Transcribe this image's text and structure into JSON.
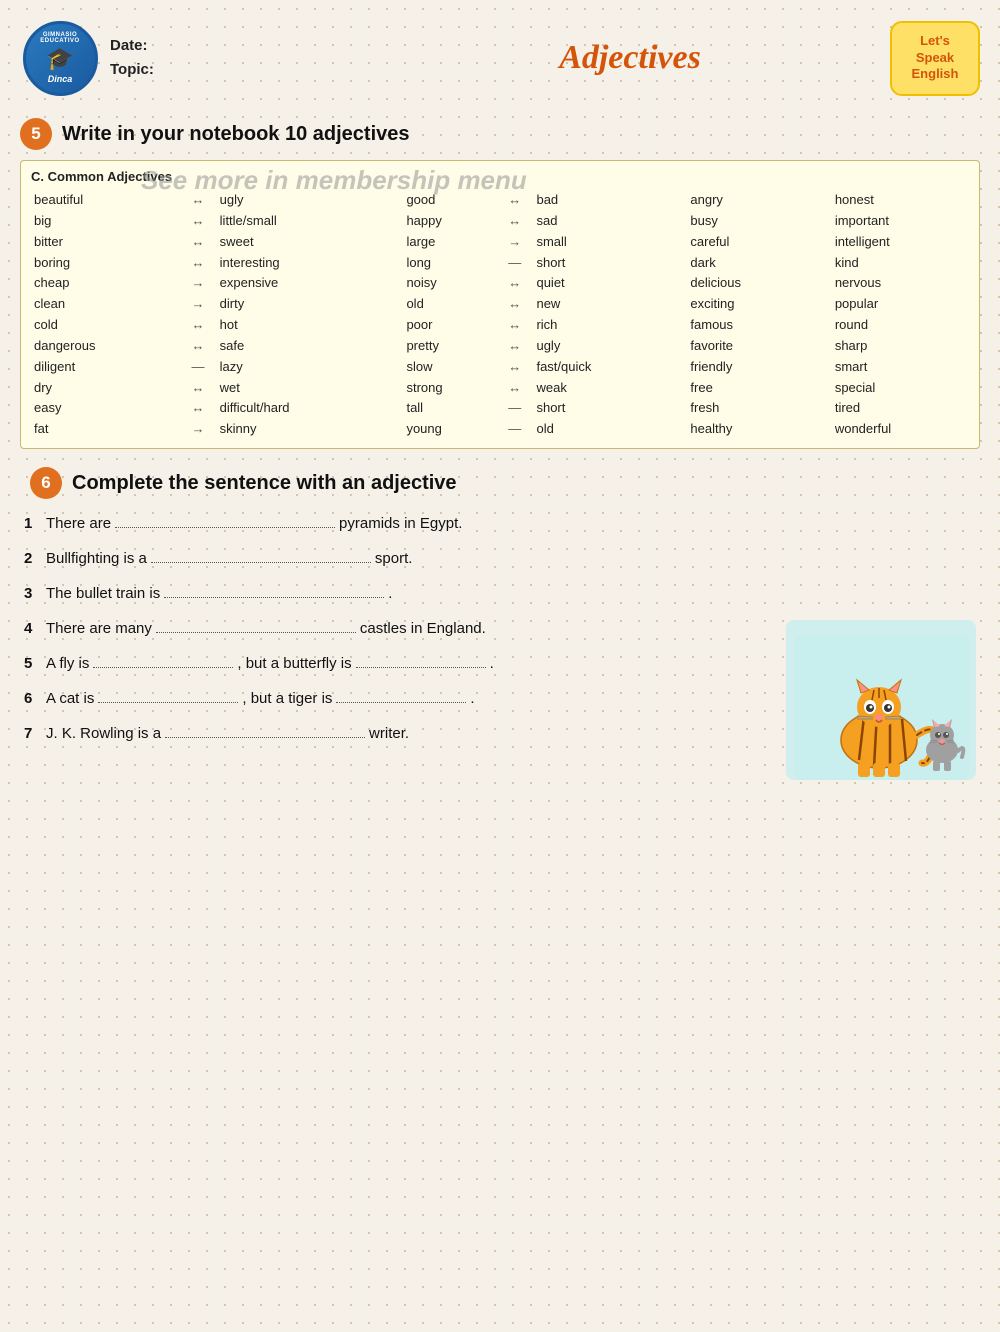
{
  "header": {
    "date_label": "Date:",
    "topic_label": "Topic:",
    "title": "Adjectives",
    "badge_line1": "Let's",
    "badge_line2": "Speak",
    "badge_line3": "English",
    "logo_top": "GIMNASIO EDUCATIVO",
    "logo_icon": "🎓",
    "logo_bottom": "Dinca"
  },
  "section5": {
    "number": "5",
    "title": "Write in your notebook 10 adjectives"
  },
  "table": {
    "label": "C. Common Adjectives",
    "membership_text": "See more in membership menu",
    "rows": [
      {
        "col1": "beautiful",
        "arr1": "↔",
        "col2": "ugly",
        "col3": "good",
        "arr2": "↔",
        "col4": "bad",
        "col5": "angry",
        "col6": "honest"
      },
      {
        "col1": "big",
        "arr1": "↔",
        "col2": "little/small",
        "col3": "happy",
        "arr2": "↔",
        "col4": "sad",
        "col5": "busy",
        "col6": "important"
      },
      {
        "col1": "bitter",
        "arr1": "↔",
        "col2": "sweet",
        "col3": "large",
        "arr2": "→",
        "col4": "small",
        "col5": "careful",
        "col6": "intelligent"
      },
      {
        "col1": "boring",
        "arr1": "↔",
        "col2": "interesting",
        "col3": "long",
        "arr2": "—",
        "col4": "short",
        "col5": "dark",
        "col6": "kind"
      },
      {
        "col1": "cheap",
        "arr1": "→",
        "col2": "expensive",
        "col3": "noisy",
        "arr2": "↔",
        "col4": "quiet",
        "col5": "delicious",
        "col6": "nervous"
      },
      {
        "col1": "clean",
        "arr1": "→",
        "col2": "dirty",
        "col3": "old",
        "arr2": "↔",
        "col4": "new",
        "col5": "exciting",
        "col6": "popular"
      },
      {
        "col1": "cold",
        "arr1": "↔",
        "col2": "hot",
        "col3": "poor",
        "arr2": "↔",
        "col4": "rich",
        "col5": "famous",
        "col6": "round"
      },
      {
        "col1": "dangerous",
        "arr1": "↔",
        "col2": "safe",
        "col3": "pretty",
        "arr2": "↔",
        "col4": "ugly",
        "col5": "favorite",
        "col6": "sharp"
      },
      {
        "col1": "diligent",
        "arr1": "—",
        "col2": "lazy",
        "col3": "slow",
        "arr2": "↔",
        "col4": "fast/quick",
        "col5": "friendly",
        "col6": "smart"
      },
      {
        "col1": "dry",
        "arr1": "↔",
        "col2": "wet",
        "col3": "strong",
        "arr2": "↔",
        "col4": "weak",
        "col5": "free",
        "col6": "special"
      },
      {
        "col1": "easy",
        "arr1": "↔",
        "col2": "difficult/hard",
        "col3": "tall",
        "arr2": "—",
        "col4": "short",
        "col5": "fresh",
        "col6": "tired"
      },
      {
        "col1": "fat",
        "arr1": "→",
        "col2": "skinny",
        "col3": "young",
        "arr2": "—",
        "col4": "old",
        "col5": "healthy",
        "col6": "wonderful"
      }
    ]
  },
  "section6": {
    "number": "6",
    "title": "Complete the sentence with an adjective",
    "exercises": [
      {
        "num": "1",
        "text_before": "There are",
        "blank_width": "220",
        "text_after": "pyramids in Egypt."
      },
      {
        "num": "2",
        "text_before": "Bullfighting is a",
        "blank_width": "220",
        "text_after": "sport."
      },
      {
        "num": "3",
        "text_before": "The bullet train is",
        "blank_width": "220",
        "text_after": "."
      },
      {
        "num": "4",
        "text_before": "There are many",
        "blank_width": "200",
        "text_after": "castles in England."
      },
      {
        "num": "5",
        "text_before": "A fly is",
        "blank_width": "150",
        "text_middle": "but a butterfly is",
        "blank_width2": "150",
        "text_after": "."
      },
      {
        "num": "6",
        "text_before": "A cat is",
        "blank_width": "150",
        "text_middle": "but a tiger is",
        "blank_width2": "150",
        "text_after": "."
      },
      {
        "num": "7",
        "text_before": "J. K. Rowling is a",
        "blank_width": "210",
        "text_after": "writer."
      }
    ]
  }
}
